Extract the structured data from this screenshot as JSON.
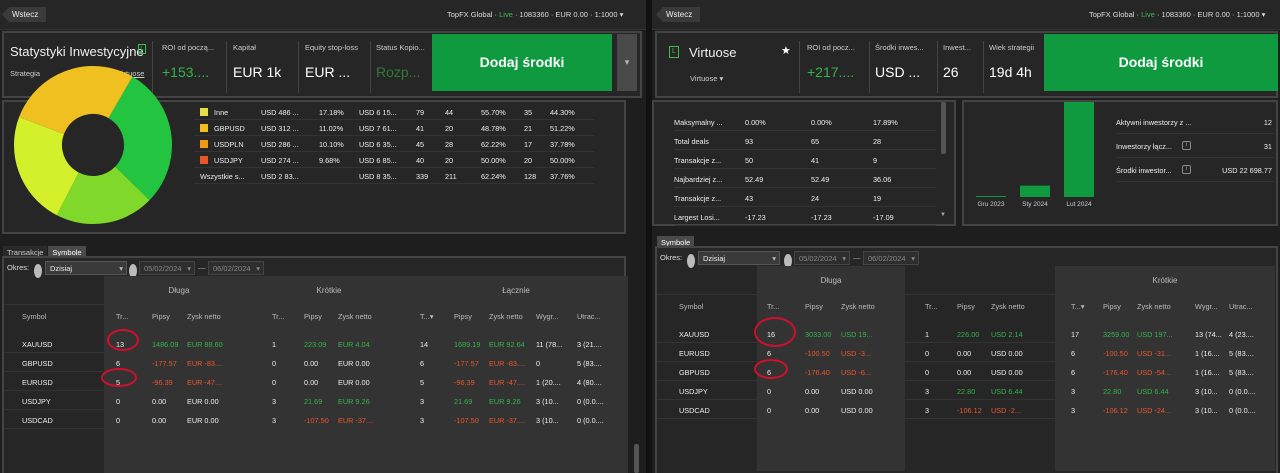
{
  "left": {
    "back": "Wstecz",
    "account": {
      "pre": "TopFX Global · ",
      "live": "Live",
      "post": " · 1083360 · EUR 0.00 · 1:1000 ▾"
    },
    "title": "Statystyki Inwestycyjne",
    "strategy_label": "Strategia",
    "strategy_value": "Virtuose",
    "stats": [
      {
        "label": "ROI od począ...",
        "value": "+153...."
      },
      {
        "label": "Kapitał",
        "value": "EUR 1k"
      },
      {
        "label": "Equity stop-loss",
        "value": "EUR ..."
      },
      {
        "label": "Status Kopio...",
        "value": "Rozp..."
      }
    ],
    "add_funds": "Dodaj środki",
    "drop": "▾",
    "pie_legend": [
      {
        "name": "Inne",
        "color": "#e5e04a",
        "c1": "USD 486 ...",
        "c2": "17.18%",
        "c3": "USD 6 15...",
        "c4": "79",
        "c5": "44",
        "c6": "55.70%",
        "c7": "35",
        "c8": "44.30%"
      },
      {
        "name": "GBPUSD",
        "color": "#f0c020",
        "c1": "USD 312 ...",
        "c2": "11.02%",
        "c3": "USD 7 61...",
        "c4": "41",
        "c5": "20",
        "c6": "48.78%",
        "c7": "21",
        "c8": "51.22%"
      },
      {
        "name": "USDPLN",
        "color": "#ee9a18",
        "c1": "USD 286 ...",
        "c2": "10.10%",
        "c3": "USD 6 35...",
        "c4": "45",
        "c5": "28",
        "c6": "62.22%",
        "c7": "17",
        "c8": "37.78%"
      },
      {
        "name": "USDJPY",
        "color": "#e8562c",
        "c1": "USD 274 ...",
        "c2": "9.68%",
        "c3": "USD 6 85...",
        "c4": "40",
        "c5": "20",
        "c6": "50.00%",
        "c7": "20",
        "c8": "50.00%"
      },
      {
        "name": "Wszystkie s...",
        "color": "",
        "c1": "USD 2 83...",
        "c2": "",
        "c3": "USD 8 35...",
        "c4": "339",
        "c5": "211",
        "c6": "62.24%",
        "c7": "128",
        "c8": "37.76%"
      }
    ],
    "tabs": [
      "Transakcje",
      "Symbole"
    ],
    "okres": "Okres:",
    "period": "Dzisiaj",
    "date_from": "05/02/2024",
    "date_to": "06/02/2024",
    "groups": [
      "Długa",
      "Krótkie",
      "Łącznie"
    ],
    "cols": [
      "Symbol",
      "Tr...",
      "Pipsy",
      "Zysk netto",
      "Tr...",
      "Pipsy",
      "Zysk netto",
      "T...▾",
      "Pipsy",
      "Zysk netto",
      "Wygr...",
      "Utrac..."
    ],
    "rows": [
      [
        "XAUUSD",
        "13",
        "1486.09",
        "EUR 88.60",
        "1",
        "223.09",
        "EUR 4.04",
        "14",
        "1689.19",
        "EUR 92.64",
        "11 (78...",
        "3 (21...."
      ],
      [
        "GBPUSD",
        "6",
        "-177.57",
        "EUR -83....",
        "0",
        "0.00",
        "EUR 0.00",
        "6",
        "-177.57",
        "EUR -83....",
        "0",
        "5 (83...."
      ],
      [
        "EURUSD",
        "5",
        "-96.39",
        "EUR -47....",
        "0",
        "0.00",
        "EUR 0.00",
        "5",
        "-96.39",
        "EUR -47....",
        "1 (20....",
        "4 (80...."
      ],
      [
        "USDJPY",
        "0",
        "0.00",
        "EUR 0.00",
        "3",
        "21.69",
        "EUR 9.26",
        "3",
        "21.69",
        "EUR 9.26",
        "3 (10...",
        "0 (0.0...."
      ],
      [
        "USDCAD",
        "0",
        "0.00",
        "EUR 0.00",
        "3",
        "-107.50",
        "EUR -37....",
        "3",
        "-107.50",
        "EUR -37....",
        "3 (10...",
        "0 (0.0...."
      ]
    ]
  },
  "right": {
    "back": "Wstecz",
    "account": {
      "pre": "TopFX Global · ",
      "live": "Live",
      "post": " · 1083360 · EUR 0.00 · 1:1000 ▾"
    },
    "title": "Virtuose",
    "strategy_value": "Virtuose ▾",
    "star": "★",
    "stats": [
      {
        "label": "ROI od pocz...",
        "value": "+217...."
      },
      {
        "label": "Środki inwes...",
        "value": "USD ..."
      },
      {
        "label": "Inwest...",
        "value": "26"
      },
      {
        "label": "Wiek strategii",
        "value": "19d 4h"
      }
    ],
    "add_funds": "Dodaj środki",
    "mini": [
      {
        "name": "Maksymalny ...",
        "a": "0.00%",
        "b": "0.00%",
        "c": "17.89%"
      },
      {
        "name": "Total deals",
        "a": "93",
        "b": "65",
        "c": "28"
      },
      {
        "name": "Transakcje z...",
        "a": "50",
        "b": "41",
        "c": "9"
      },
      {
        "name": "Najbardziej z...",
        "a": "52.49",
        "b": "52.49",
        "c": "36.06"
      },
      {
        "name": "Transakcje z...",
        "a": "43",
        "b": "24",
        "c": "19"
      },
      {
        "name": "Largest Losi...",
        "a": "-17.23",
        "b": "-17.23",
        "c": "-17.09"
      }
    ],
    "bar_chart": {
      "type": "bar",
      "categories": [
        "Gru 2023",
        "Sty 2024",
        "Lut 2024"
      ],
      "values": [
        1,
        12,
        100
      ]
    },
    "investors": [
      {
        "label": "Aktywni inwestorzy z ...",
        "value": "12"
      },
      {
        "label": "Inwestorzy łącz...",
        "value": "31"
      },
      {
        "label": "Środki inwestor...",
        "value": "USD 22 698.77"
      }
    ],
    "tabs": [
      "Symbole"
    ],
    "okres": "Okres:",
    "period": "Dzisiaj",
    "date_from": "05/02/2024",
    "date_to": "06/02/2024",
    "groups": [
      "Długa",
      "Krótkie",
      "Łącznie"
    ],
    "cols": [
      "Symbol",
      "Tr...",
      "Pipsy",
      "Zysk netto",
      "Tr...",
      "Pipsy",
      "Zysk netto",
      "T...▾",
      "Pipsy",
      "Zysk netto",
      "Wygr...",
      "Utrac..."
    ],
    "rows": [
      [
        "XAUUSD",
        "16",
        "3033.00",
        "USD 19...",
        "1",
        "226.00",
        "USD 2.14",
        "17",
        "3259.00",
        "USD 197...",
        "13 (74...",
        "4 (23...."
      ],
      [
        "EURUSD",
        "6",
        "-100.50",
        "USD -3...",
        "0",
        "0.00",
        "USD 0.00",
        "6",
        "-100.50",
        "USD -31...",
        "1 (16....",
        "5 (83...."
      ],
      [
        "GBPUSD",
        "6",
        "-176.40",
        "USD -6...",
        "0",
        "0.00",
        "USD 0.00",
        "6",
        "-176.40",
        "USD -54...",
        "1 (16....",
        "5 (83...."
      ],
      [
        "USDJPY",
        "0",
        "0.00",
        "USD 0.00",
        "3",
        "22.80",
        "USD 6.44",
        "3",
        "22.80",
        "USD 6.44",
        "3 (10...",
        "0 (0.0...."
      ],
      [
        "USDCAD",
        "0",
        "0.00",
        "USD 0.00",
        "3",
        "-106.12",
        "USD -2...",
        "3",
        "-106.12",
        "USD -24...",
        "3 (10...",
        "0 (0.0...."
      ]
    ]
  }
}
